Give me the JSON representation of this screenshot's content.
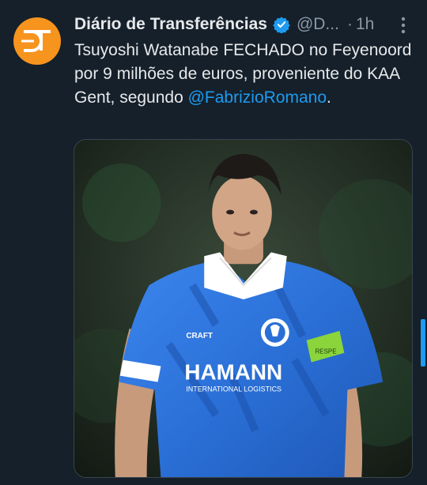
{
  "post": {
    "author_name": "Diário de Transferências",
    "author_handle": "@D...",
    "separator": "·",
    "timestamp": "1h",
    "avatar_initials": "DT",
    "text_prefix": "Tsuyoshi Watanabe FECHADO no Feyenoord por 9 milhões de euros, proveniente do KAA Gent, segundo ",
    "mention": "@FabrizioRomano",
    "text_suffix": ".",
    "verified": true
  },
  "photo": {
    "sponsor_text": "HAMANN",
    "sponsor_subtext": "INTERNATIONAL LOGISTICS",
    "kit_brand": "CRAFT",
    "captain_band_text": "RESPE"
  },
  "colors": {
    "background": "#15202b",
    "text": "#e7e9ea",
    "secondary_text": "#8b98a5",
    "link": "#1d9bf0",
    "avatar": "#f7941d",
    "jersey": "#2a6fd6",
    "captain_band": "#8bd43c"
  },
  "icons": {
    "verified": "verified-badge-icon",
    "more": "more-options-icon"
  }
}
